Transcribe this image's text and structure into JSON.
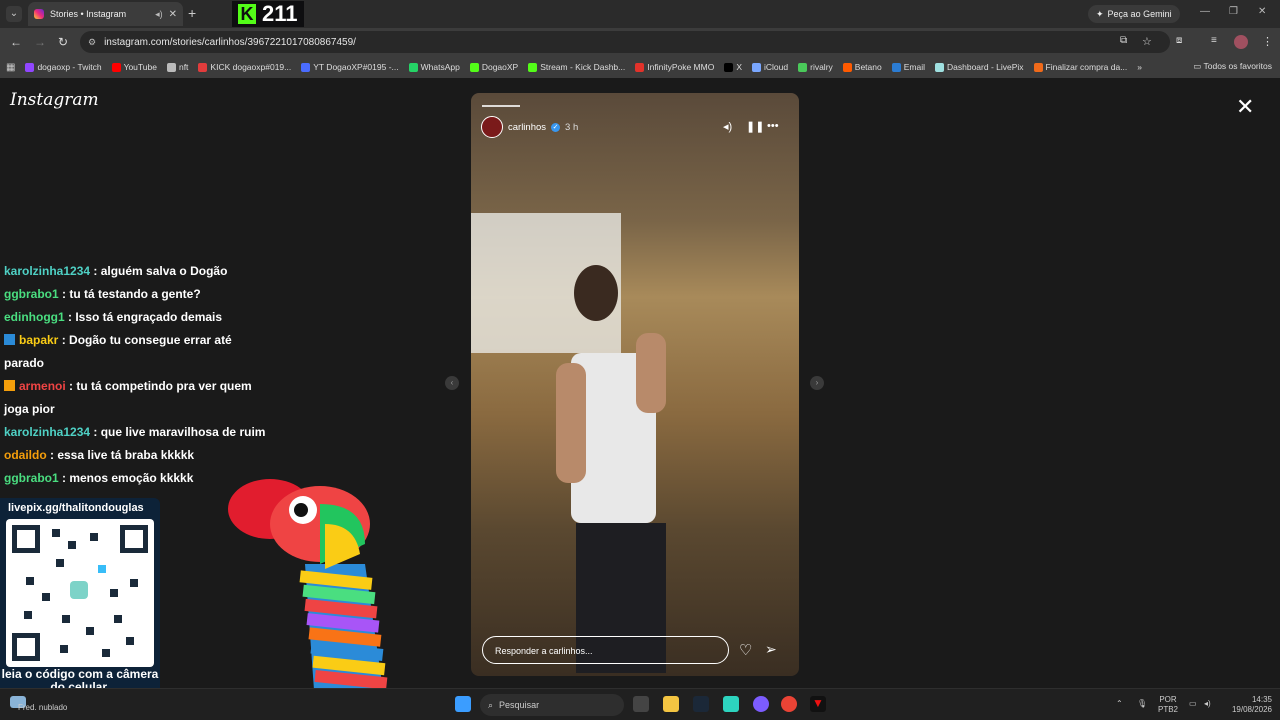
{
  "browser": {
    "tab_title": "Stories • Instagram",
    "new_tab": "+",
    "kick_count": "211",
    "gemini_label": "Peça ao Gemini",
    "url": "instagram.com/stories/carlinhos/3967221017080867459/",
    "bookmarks": [
      {
        "label": "dogaoxp - Twitch",
        "color": "#9146ff"
      },
      {
        "label": "YouTube",
        "color": "#ff0000"
      },
      {
        "label": "nft",
        "color": "#bbbbbb"
      },
      {
        "label": "KICK dogaoxp#019...",
        "color": "#e23c3c"
      },
      {
        "label": "YT DogaoXP#0195 -...",
        "color": "#4a6cff"
      },
      {
        "label": "WhatsApp",
        "color": "#25d366"
      },
      {
        "label": "DogaoXP",
        "color": "#53fc18"
      },
      {
        "label": "Stream - Kick Dashb...",
        "color": "#53fc18"
      },
      {
        "label": "InfinityPoke MMO",
        "color": "#e2322a"
      },
      {
        "label": "X",
        "color": "#000000"
      },
      {
        "label": "iCloud",
        "color": "#7aa7ff"
      },
      {
        "label": "rivalry",
        "color": "#4ac95a"
      },
      {
        "label": "Betano",
        "color": "#ff5a00"
      },
      {
        "label": "Email",
        "color": "#2b7cd3"
      },
      {
        "label": "Dashboard - LivePix",
        "color": "#9fe0e0"
      },
      {
        "label": "Finalizar compra da...",
        "color": "#f06a1a"
      }
    ],
    "all_bookmarks": "Todos os favoritos"
  },
  "instagram": {
    "logo": "Instagram",
    "story": {
      "username": "carlinhos",
      "time": "3 h",
      "reply_placeholder": "Responder a carlinhos..."
    }
  },
  "chat": [
    {
      "user": "karolzinha1234",
      "color": "#4fd1c5",
      "msg": " : alguém salva o Dogão",
      "badge": ""
    },
    {
      "user": "ggbrabo1",
      "color": "#4ade80",
      "msg": " : tu tá testando a gente?",
      "badge": ""
    },
    {
      "user": "edinhogg1",
      "color": "#4ade80",
      "msg": " : Isso tá engraçado demais",
      "badge": ""
    },
    {
      "user": "bapakr",
      "color": "#facc15",
      "msg": " : Dogão tu consegue errar até parado",
      "badge": "#2b8bd8"
    },
    {
      "user": "armenoi",
      "color": "#ef4444",
      "msg": " : tu tá competindo pra ver quem joga pior",
      "badge": "#f59e0b"
    },
    {
      "user": "karolzinha1234",
      "color": "#4fd1c5",
      "msg": " : que live maravilhosa de ruim",
      "badge": ""
    },
    {
      "user": "odaildo",
      "color": "#f59e0b",
      "msg": " : essa live tá braba kkkkk",
      "badge": ""
    },
    {
      "user": "ggbrabo1",
      "color": "#4ade80",
      "msg": " : menos emoção kkkkk",
      "badge": ""
    }
  ],
  "overlay": {
    "livepix": "livepix.gg/thalitondouglas",
    "qr_caption": "leia o código com a câmera do celular."
  },
  "taskbar": {
    "weather": "Fred. nublado",
    "search": "Pesquisar",
    "lang": "POR",
    "lang2": "PTB2",
    "time": "14:35",
    "date": "19/08/2026"
  }
}
